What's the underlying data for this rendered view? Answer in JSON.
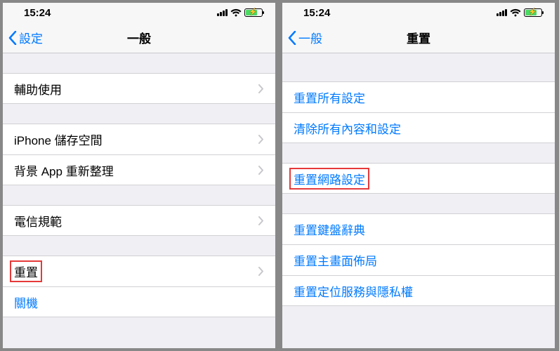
{
  "statusTime": "15:24",
  "left": {
    "backLabel": "設定",
    "title": "一般",
    "groups": [
      {
        "items": [
          {
            "label": "輔助使用",
            "chevron": true
          }
        ]
      },
      {
        "items": [
          {
            "label": "iPhone 儲存空間",
            "chevron": true
          },
          {
            "label": "背景 App 重新整理",
            "chevron": true
          }
        ]
      },
      {
        "items": [
          {
            "label": "電信規範",
            "chevron": true
          }
        ]
      },
      {
        "items": [
          {
            "label": "重置",
            "chevron": true,
            "highlight": true
          },
          {
            "label": "關機",
            "chevron": false,
            "blue": true
          }
        ]
      }
    ]
  },
  "right": {
    "backLabel": "一般",
    "title": "重置",
    "groups": [
      {
        "items": [
          {
            "label": "重置所有設定",
            "blue": true
          },
          {
            "label": "清除所有內容和設定",
            "blue": true
          }
        ]
      },
      {
        "items": [
          {
            "label": "重置網路設定",
            "blue": true,
            "highlight": true
          }
        ]
      },
      {
        "items": [
          {
            "label": "重置鍵盤辭典",
            "blue": true
          },
          {
            "label": "重置主畫面佈局",
            "blue": true
          },
          {
            "label": "重置定位服務與隱私權",
            "blue": true
          }
        ]
      }
    ]
  }
}
